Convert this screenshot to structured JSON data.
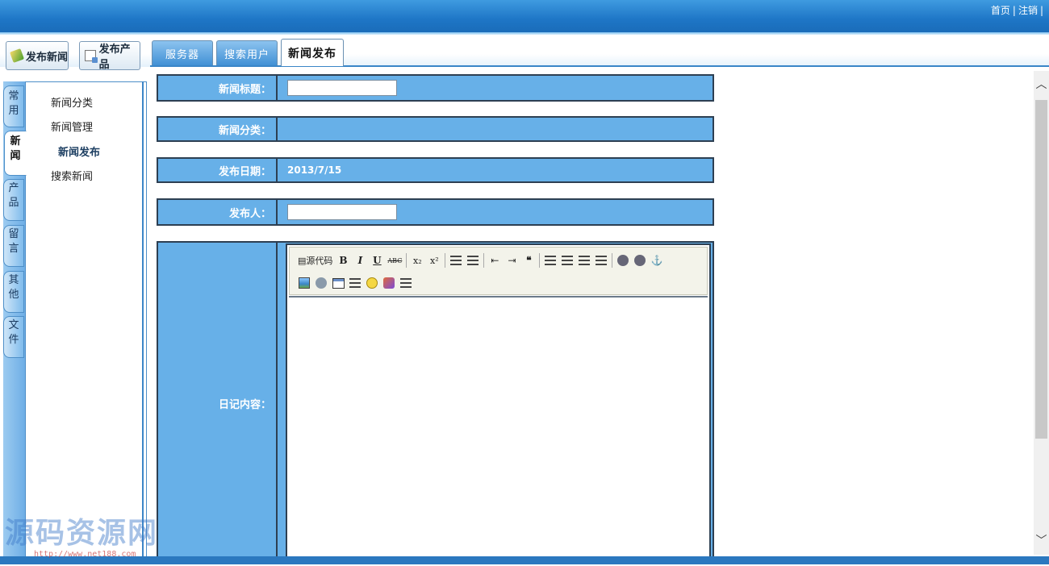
{
  "top_links": {
    "home": "首页",
    "logout": "注销",
    "separator": "|"
  },
  "quick_buttons": {
    "publish_news": "发布新闻",
    "publish_product": "发布产品"
  },
  "tabs": [
    {
      "label": "服务器",
      "active": false
    },
    {
      "label": "搜索用户",
      "active": false
    },
    {
      "label": "新闻发布",
      "active": true
    }
  ],
  "vertical_tabs": [
    {
      "label": "常用",
      "active": false
    },
    {
      "label": "新闻",
      "active": true
    },
    {
      "label": "产品",
      "active": false
    },
    {
      "label": "留言",
      "active": false
    },
    {
      "label": "其他",
      "active": false
    },
    {
      "label": "文件",
      "active": false
    }
  ],
  "left_nav": [
    {
      "label": "新闻分类"
    },
    {
      "label": "新闻管理"
    },
    {
      "label": "新闻发布",
      "selected": true
    },
    {
      "label": "搜索新闻"
    }
  ],
  "form": {
    "title_label": "新闻标题：",
    "title_value": "",
    "category_label": "新闻分类：",
    "date_label": "发布日期：",
    "date_value": "2013/7/15",
    "author_label": "发布人：",
    "author_value": "",
    "content_label": "日记内容："
  },
  "editor_toolbar": {
    "source_label": "源代码",
    "bold": "B",
    "italic": "I",
    "underline": "U",
    "strike": "ABC",
    "subscript": "x₂",
    "superscript": "x²",
    "outdent": "⇤",
    "indent": "⇥",
    "quote": "❝",
    "anchor": "⚓"
  },
  "colors": {
    "topbar": "#1e76c6",
    "form_row_bg": "#67b0e8",
    "form_border": "#2d3f52"
  },
  "watermark": {
    "text": "源码资源网",
    "url": "http://www.net188.com"
  }
}
